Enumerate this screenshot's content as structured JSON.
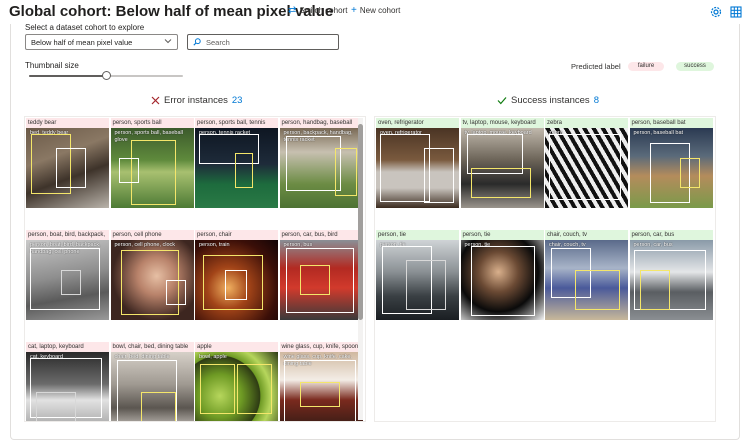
{
  "header": {
    "title": "Global cohort: Below half of mean pixel value",
    "switch_cohort": "Switch cohort",
    "new_cohort": "New cohort"
  },
  "cohort": {
    "select_label": "Select a dataset cohort to explore",
    "selected": "Below half of mean pixel value"
  },
  "search": {
    "placeholder": "Search"
  },
  "thumbnail": {
    "label": "Thumbnail size",
    "level": 0.5
  },
  "predicted_label": {
    "label": "Predicted label",
    "failure": "failure",
    "success": "success",
    "failure_color": "#fde7e9",
    "success_color": "#dff6dd"
  },
  "error_section": {
    "label": "Error instances",
    "count": "23",
    "icon": "close-icon",
    "icon_color": "#a4262c"
  },
  "success_section": {
    "label": "Success instances",
    "count": "8",
    "icon": "check-icon",
    "icon_color": "#107c10"
  },
  "error_tiles": [
    {
      "label": "teddy bear",
      "image": "teddy-bear",
      "box_text": "bed, teddy bear"
    },
    {
      "label": "person, sports ball",
      "image": "baseball-field",
      "box_text": "person, sports ball, baseball glove"
    },
    {
      "label": "person, sports ball, tennis",
      "image": "tennis-court",
      "box_text": "person, tennis racket"
    },
    {
      "label": "person, handbag, baseball",
      "image": "baseball-stadium",
      "box_text": "person, backpack, handbag, tennis racket"
    },
    {
      "label": "person, boat, bird, backpack,",
      "image": "boat-rain",
      "box_text": "person, boat, bird, backpack, handbag, cell phone"
    },
    {
      "label": "person, cell phone",
      "image": "woman-phone",
      "box_text": "person, cell phone, clock"
    },
    {
      "label": "person, chair",
      "image": "night-lights",
      "box_text": "person, train"
    },
    {
      "label": "person, car, bus, bird",
      "image": "red-bus",
      "box_text": "person, bus"
    },
    {
      "label": "cat, laptop, keyboard",
      "image": "cat-laptop",
      "box_text": "cat, keyboard"
    },
    {
      "label": "bowl, chair, bed, dining table",
      "image": "bedroom",
      "box_text": "chair, bed, dining table"
    },
    {
      "label": "apple",
      "image": "green-apples",
      "box_text": "bowl, apple"
    },
    {
      "label": "wine glass, cup, knife, spoon,",
      "image": "dining-table",
      "box_text": "wine glass, cup, knife, cake, dining table"
    }
  ],
  "success_tiles": [
    {
      "label": "oven, refrigerator",
      "image": "kitchen",
      "box_text": "oven, refrigerator"
    },
    {
      "label": "tv, laptop, mouse, keyboard",
      "image": "desk",
      "box_text": "tv, laptop, mouse, keyboard"
    },
    {
      "label": "zebra",
      "image": "zebra",
      "box_text": "zebra"
    },
    {
      "label": "person, baseball bat",
      "image": "baseball-batter",
      "box_text": "person, baseball bat"
    },
    {
      "label": "person, tie",
      "image": "office",
      "box_text": "person, tie"
    },
    {
      "label": "person, tie",
      "image": "young-man",
      "box_text": "person, tie"
    },
    {
      "label": "chair, couch, tv",
      "image": "living-room",
      "box_text": "chair, couch, tv"
    },
    {
      "label": "person, car, bus",
      "image": "white-bus",
      "box_text": "person, car, bus"
    }
  ]
}
